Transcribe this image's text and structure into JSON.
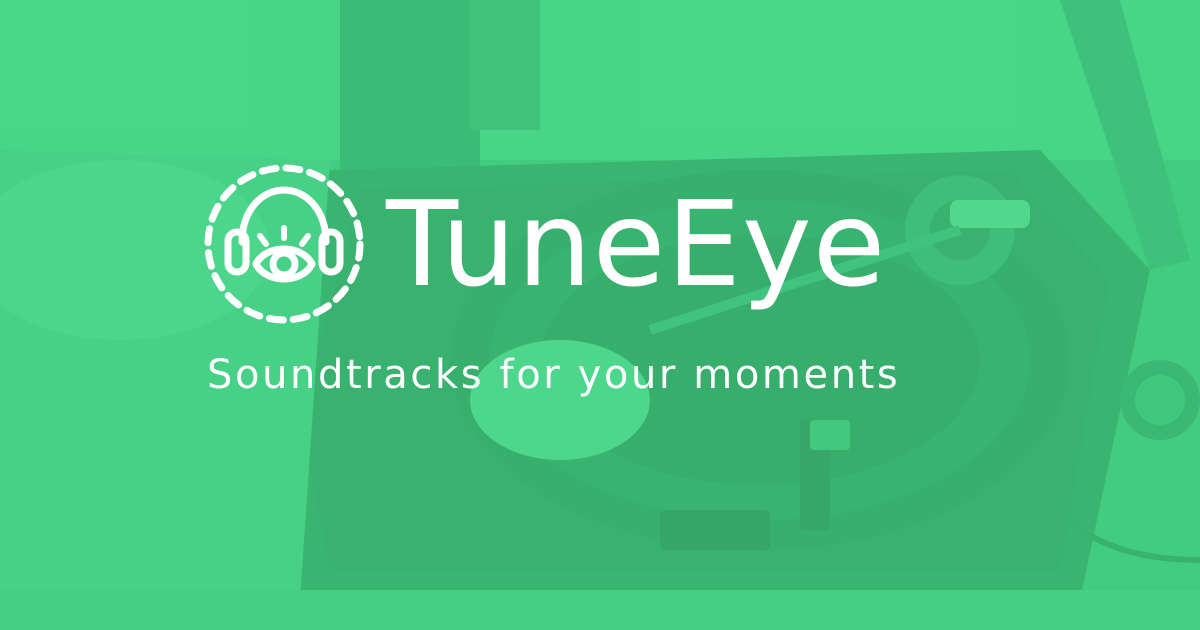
{
  "brand": {
    "name": "TuneEye",
    "tagline": "Soundtracks for your moments",
    "logo_icon": "headphones-eye-icon"
  },
  "background": {
    "subject": "turntable-photo",
    "tint_color": "#46d686",
    "text_color": "#ffffff"
  }
}
